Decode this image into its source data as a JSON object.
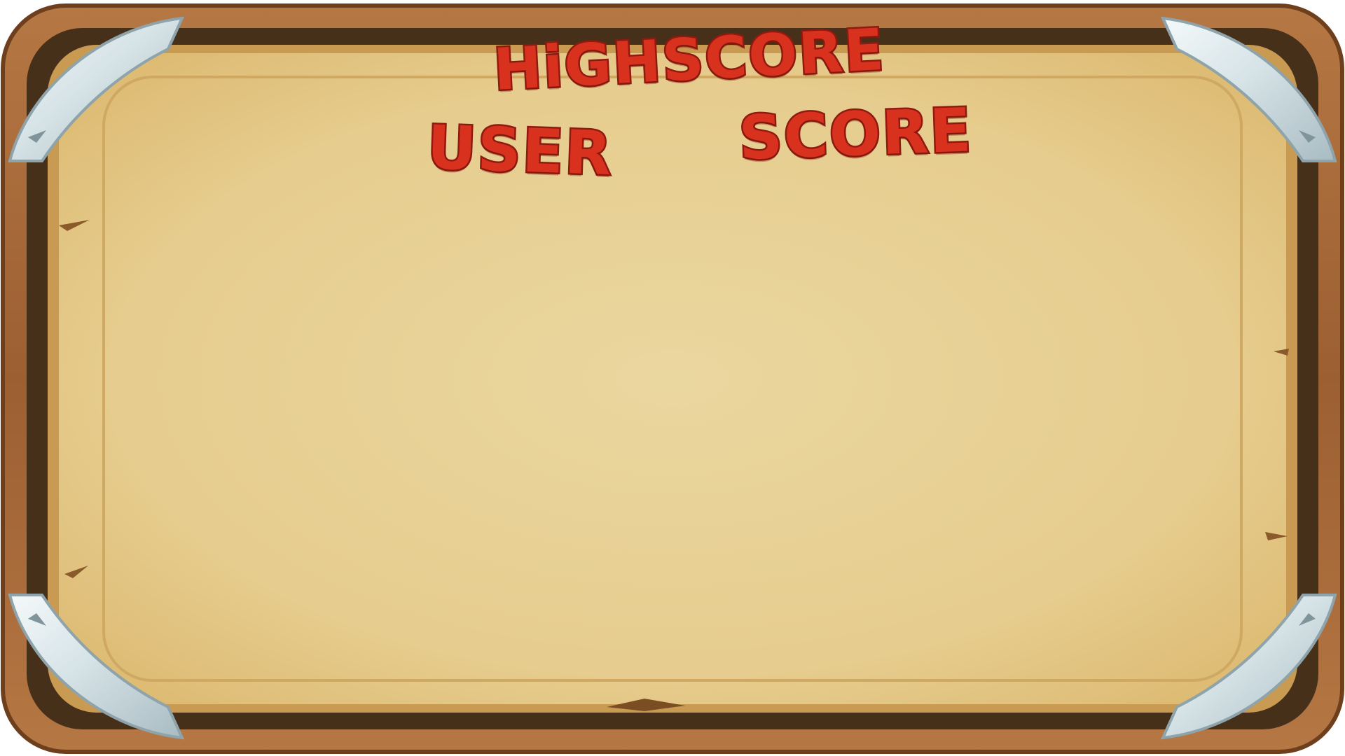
{
  "highscore_board": {
    "title": "HiGHSCORE",
    "columns": {
      "user": "USER",
      "score": "SCORE"
    },
    "entries": []
  },
  "colors": {
    "heading_fill": "#d8321f",
    "heading_outline": "#8e1a10",
    "parchment": "#e8d39c",
    "wood_outer": "#a8693a",
    "wood_dark": "#47301a",
    "metal_corner": "#cfdde2"
  }
}
